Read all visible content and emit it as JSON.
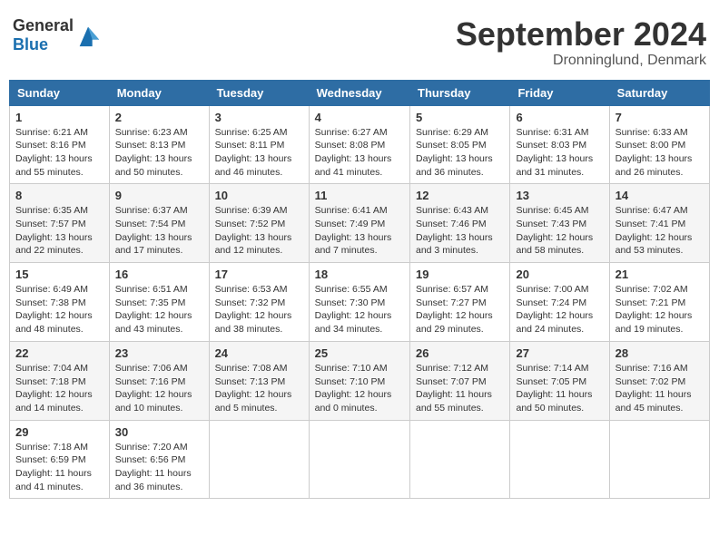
{
  "header": {
    "logo_general": "General",
    "logo_blue": "Blue",
    "month_title": "September 2024",
    "location": "Dronninglund, Denmark"
  },
  "days_of_week": [
    "Sunday",
    "Monday",
    "Tuesday",
    "Wednesday",
    "Thursday",
    "Friday",
    "Saturday"
  ],
  "weeks": [
    [
      {
        "day": "1",
        "sunrise": "6:21 AM",
        "sunset": "8:16 PM",
        "daylight": "13 hours and 55 minutes."
      },
      {
        "day": "2",
        "sunrise": "6:23 AM",
        "sunset": "8:13 PM",
        "daylight": "13 hours and 50 minutes."
      },
      {
        "day": "3",
        "sunrise": "6:25 AM",
        "sunset": "8:11 PM",
        "daylight": "13 hours and 46 minutes."
      },
      {
        "day": "4",
        "sunrise": "6:27 AM",
        "sunset": "8:08 PM",
        "daylight": "13 hours and 41 minutes."
      },
      {
        "day": "5",
        "sunrise": "6:29 AM",
        "sunset": "8:05 PM",
        "daylight": "13 hours and 36 minutes."
      },
      {
        "day": "6",
        "sunrise": "6:31 AM",
        "sunset": "8:03 PM",
        "daylight": "13 hours and 31 minutes."
      },
      {
        "day": "7",
        "sunrise": "6:33 AM",
        "sunset": "8:00 PM",
        "daylight": "13 hours and 26 minutes."
      }
    ],
    [
      {
        "day": "8",
        "sunrise": "6:35 AM",
        "sunset": "7:57 PM",
        "daylight": "13 hours and 22 minutes."
      },
      {
        "day": "9",
        "sunrise": "6:37 AM",
        "sunset": "7:54 PM",
        "daylight": "13 hours and 17 minutes."
      },
      {
        "day": "10",
        "sunrise": "6:39 AM",
        "sunset": "7:52 PM",
        "daylight": "13 hours and 12 minutes."
      },
      {
        "day": "11",
        "sunrise": "6:41 AM",
        "sunset": "7:49 PM",
        "daylight": "13 hours and 7 minutes."
      },
      {
        "day": "12",
        "sunrise": "6:43 AM",
        "sunset": "7:46 PM",
        "daylight": "13 hours and 3 minutes."
      },
      {
        "day": "13",
        "sunrise": "6:45 AM",
        "sunset": "7:43 PM",
        "daylight": "12 hours and 58 minutes."
      },
      {
        "day": "14",
        "sunrise": "6:47 AM",
        "sunset": "7:41 PM",
        "daylight": "12 hours and 53 minutes."
      }
    ],
    [
      {
        "day": "15",
        "sunrise": "6:49 AM",
        "sunset": "7:38 PM",
        "daylight": "12 hours and 48 minutes."
      },
      {
        "day": "16",
        "sunrise": "6:51 AM",
        "sunset": "7:35 PM",
        "daylight": "12 hours and 43 minutes."
      },
      {
        "day": "17",
        "sunrise": "6:53 AM",
        "sunset": "7:32 PM",
        "daylight": "12 hours and 38 minutes."
      },
      {
        "day": "18",
        "sunrise": "6:55 AM",
        "sunset": "7:30 PM",
        "daylight": "12 hours and 34 minutes."
      },
      {
        "day": "19",
        "sunrise": "6:57 AM",
        "sunset": "7:27 PM",
        "daylight": "12 hours and 29 minutes."
      },
      {
        "day": "20",
        "sunrise": "7:00 AM",
        "sunset": "7:24 PM",
        "daylight": "12 hours and 24 minutes."
      },
      {
        "day": "21",
        "sunrise": "7:02 AM",
        "sunset": "7:21 PM",
        "daylight": "12 hours and 19 minutes."
      }
    ],
    [
      {
        "day": "22",
        "sunrise": "7:04 AM",
        "sunset": "7:18 PM",
        "daylight": "12 hours and 14 minutes."
      },
      {
        "day": "23",
        "sunrise": "7:06 AM",
        "sunset": "7:16 PM",
        "daylight": "12 hours and 10 minutes."
      },
      {
        "day": "24",
        "sunrise": "7:08 AM",
        "sunset": "7:13 PM",
        "daylight": "12 hours and 5 minutes."
      },
      {
        "day": "25",
        "sunrise": "7:10 AM",
        "sunset": "7:10 PM",
        "daylight": "12 hours and 0 minutes."
      },
      {
        "day": "26",
        "sunrise": "7:12 AM",
        "sunset": "7:07 PM",
        "daylight": "11 hours and 55 minutes."
      },
      {
        "day": "27",
        "sunrise": "7:14 AM",
        "sunset": "7:05 PM",
        "daylight": "11 hours and 50 minutes."
      },
      {
        "day": "28",
        "sunrise": "7:16 AM",
        "sunset": "7:02 PM",
        "daylight": "11 hours and 45 minutes."
      }
    ],
    [
      {
        "day": "29",
        "sunrise": "7:18 AM",
        "sunset": "6:59 PM",
        "daylight": "11 hours and 41 minutes."
      },
      {
        "day": "30",
        "sunrise": "7:20 AM",
        "sunset": "6:56 PM",
        "daylight": "11 hours and 36 minutes."
      },
      null,
      null,
      null,
      null,
      null
    ]
  ]
}
